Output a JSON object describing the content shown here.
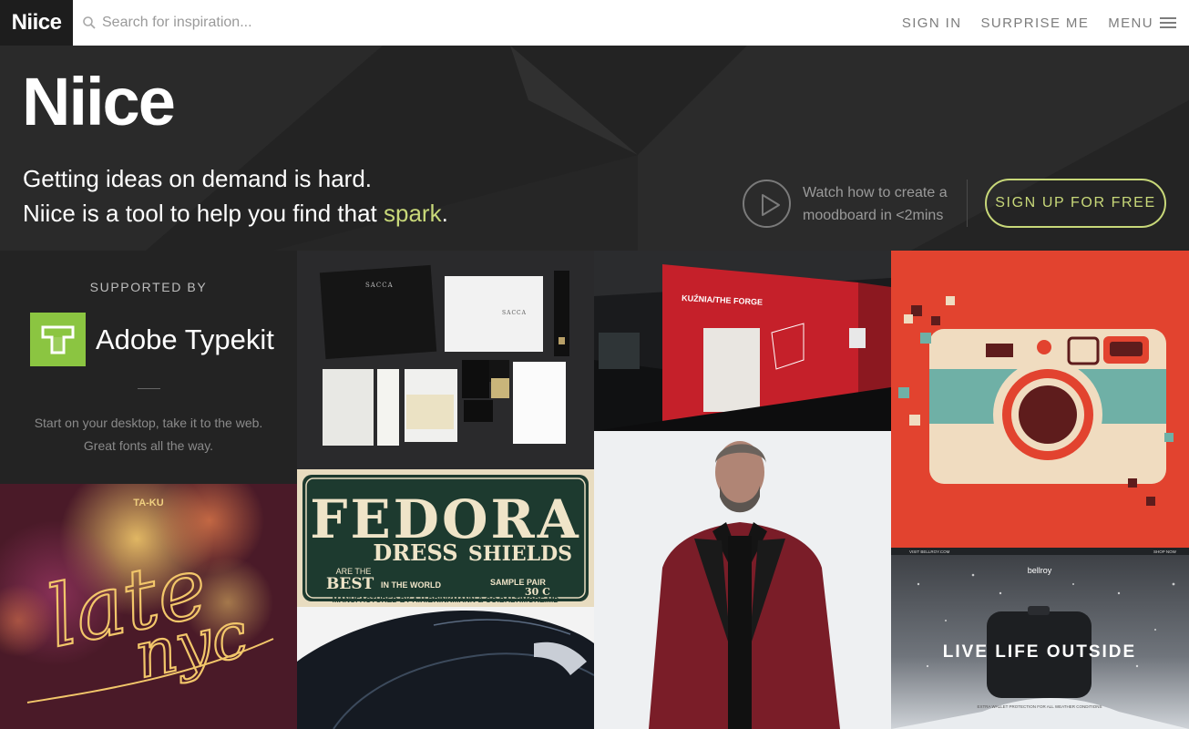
{
  "topbar": {
    "logo": "Niice",
    "search_placeholder": "Search for inspiration...",
    "nav": [
      {
        "label": "SIGN IN"
      },
      {
        "label": "SURPRISE ME"
      },
      {
        "label": "MENU"
      }
    ]
  },
  "hero": {
    "logo": "Niice",
    "line1": "Getting ideas on demand is hard.",
    "line2_prefix": "Niice is a tool to help you find that ",
    "line2_highlight": "spark",
    "line2_suffix": ".",
    "watch_line1": "Watch how to create a",
    "watch_line2": "moodboard in <2mins",
    "signup_label": "SIGN UP FOR FREE"
  },
  "sponsor": {
    "supported_by": "SUPPORTED BY",
    "brand": "Adobe Typekit",
    "copy_line1": "Start on your desktop, take it to the web.",
    "copy_line2": "Great fonts all the way."
  },
  "tiles": {
    "sacca_label": "SACCA",
    "forge_title": "KUŹNIA/THE FORGE",
    "taku": "TA-KU",
    "late": "late",
    "nyc": "nyc",
    "fedora_title": "FEDORA",
    "fedora_dress": "DRESS",
    "fedora_are_the": "ARE THE",
    "fedora_shields": "SHIELDS",
    "fedora_best": "BEST",
    "fedora_in_world": "IN THE WORLD",
    "fedora_sample": "SAMPLE PAIR",
    "fedora_price": "30 C",
    "fedora_mfg": "MANUFACTURED BY A.H.BRINKMANN & CO.BALTIMORE.MD",
    "bellroy_brand": "bellroy",
    "bellroy_headline": "LIVE LIFE OUTSIDE",
    "bellroy_visit": "VISIT BELLROY.COM",
    "bellroy_shop": "SHOP NOW",
    "bellroy_sub": "EXTRA WALLET PROTECTION FOR ALL WEATHER CONDITIONS"
  },
  "colors": {
    "accent": "#c8d879",
    "typekit_green": "#8bc541",
    "camera_red": "#e2432f"
  }
}
